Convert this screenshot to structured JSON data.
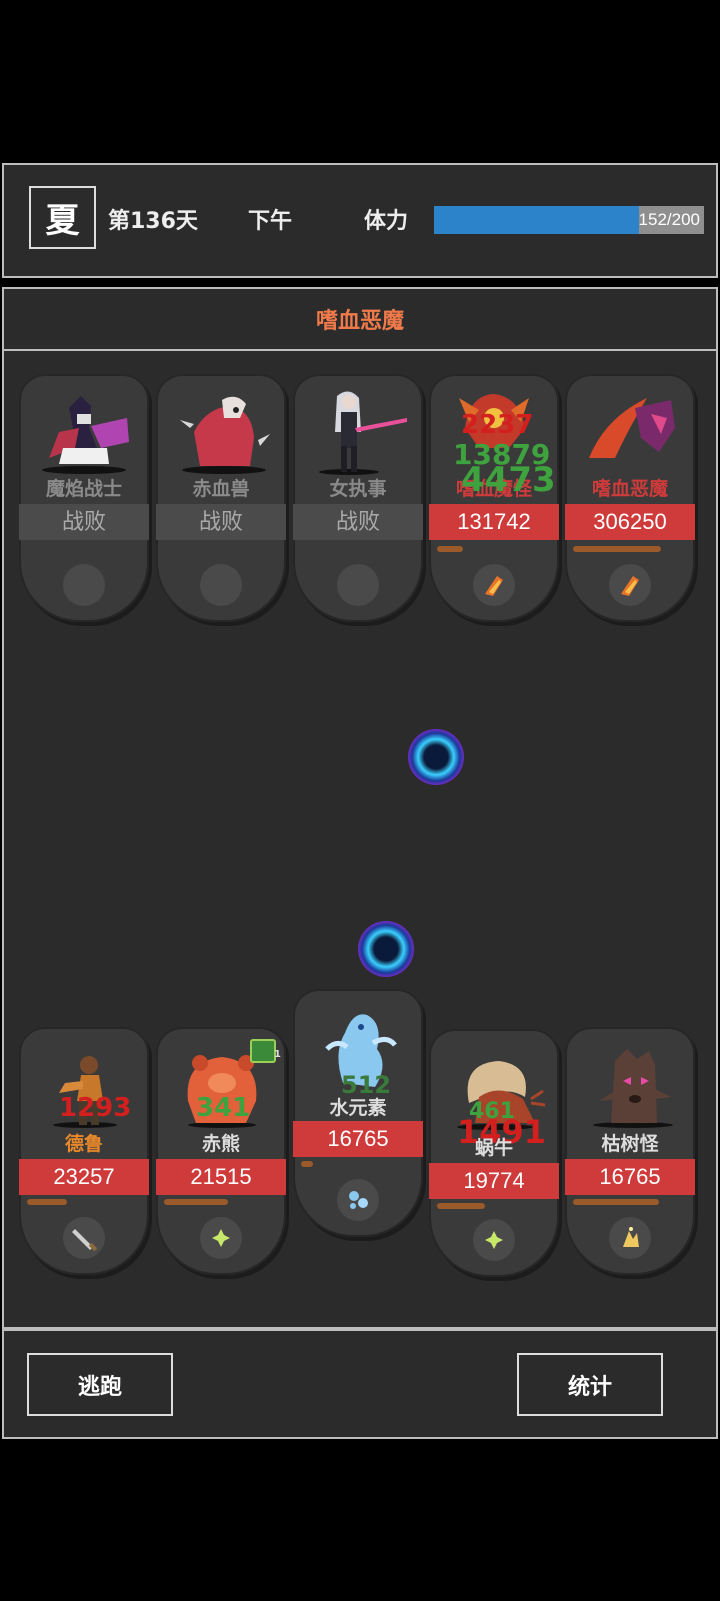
{
  "status": {
    "season": "夏",
    "day": "第136天",
    "time_of_day": "下午",
    "stamina_label": "体力",
    "stamina_text": "152/200",
    "stamina_fraction": 0.76
  },
  "battle_title": "嗜血恶魔",
  "enemies": [
    {
      "name": "魔焰战士",
      "hp": "战败",
      "defeated": true
    },
    {
      "name": "赤血兽",
      "hp": "战败",
      "defeated": true
    },
    {
      "name": "女执事",
      "hp": "战败",
      "defeated": true
    },
    {
      "name": "嗜血魔怪",
      "hp": "131742",
      "defeated": false
    },
    {
      "name": "嗜血恶魔",
      "hp": "306250",
      "defeated": false
    }
  ],
  "allies": [
    {
      "name": "德鲁",
      "hp": "23257"
    },
    {
      "name": "赤熊",
      "hp": "21515"
    },
    {
      "name": "水元素",
      "hp": "16765"
    },
    {
      "name": "蜗牛",
      "hp": "19774"
    },
    {
      "name": "枯树怪",
      "hp": "16765"
    }
  ],
  "damage_numbers": {
    "e4_a": "2237",
    "e4_b": "13879",
    "e4_c": "4473",
    "a1": "1293",
    "a2": "341",
    "a2_badge": "1",
    "a3": "512",
    "a4_a": "461",
    "a4_b": "1491"
  },
  "buttons": {
    "flee": "逃跑",
    "stats": "统计"
  },
  "colors": {
    "hp_red": "#cf3a3a",
    "title_orange": "#f07a4a",
    "stamina_blue": "#2d83c9"
  }
}
